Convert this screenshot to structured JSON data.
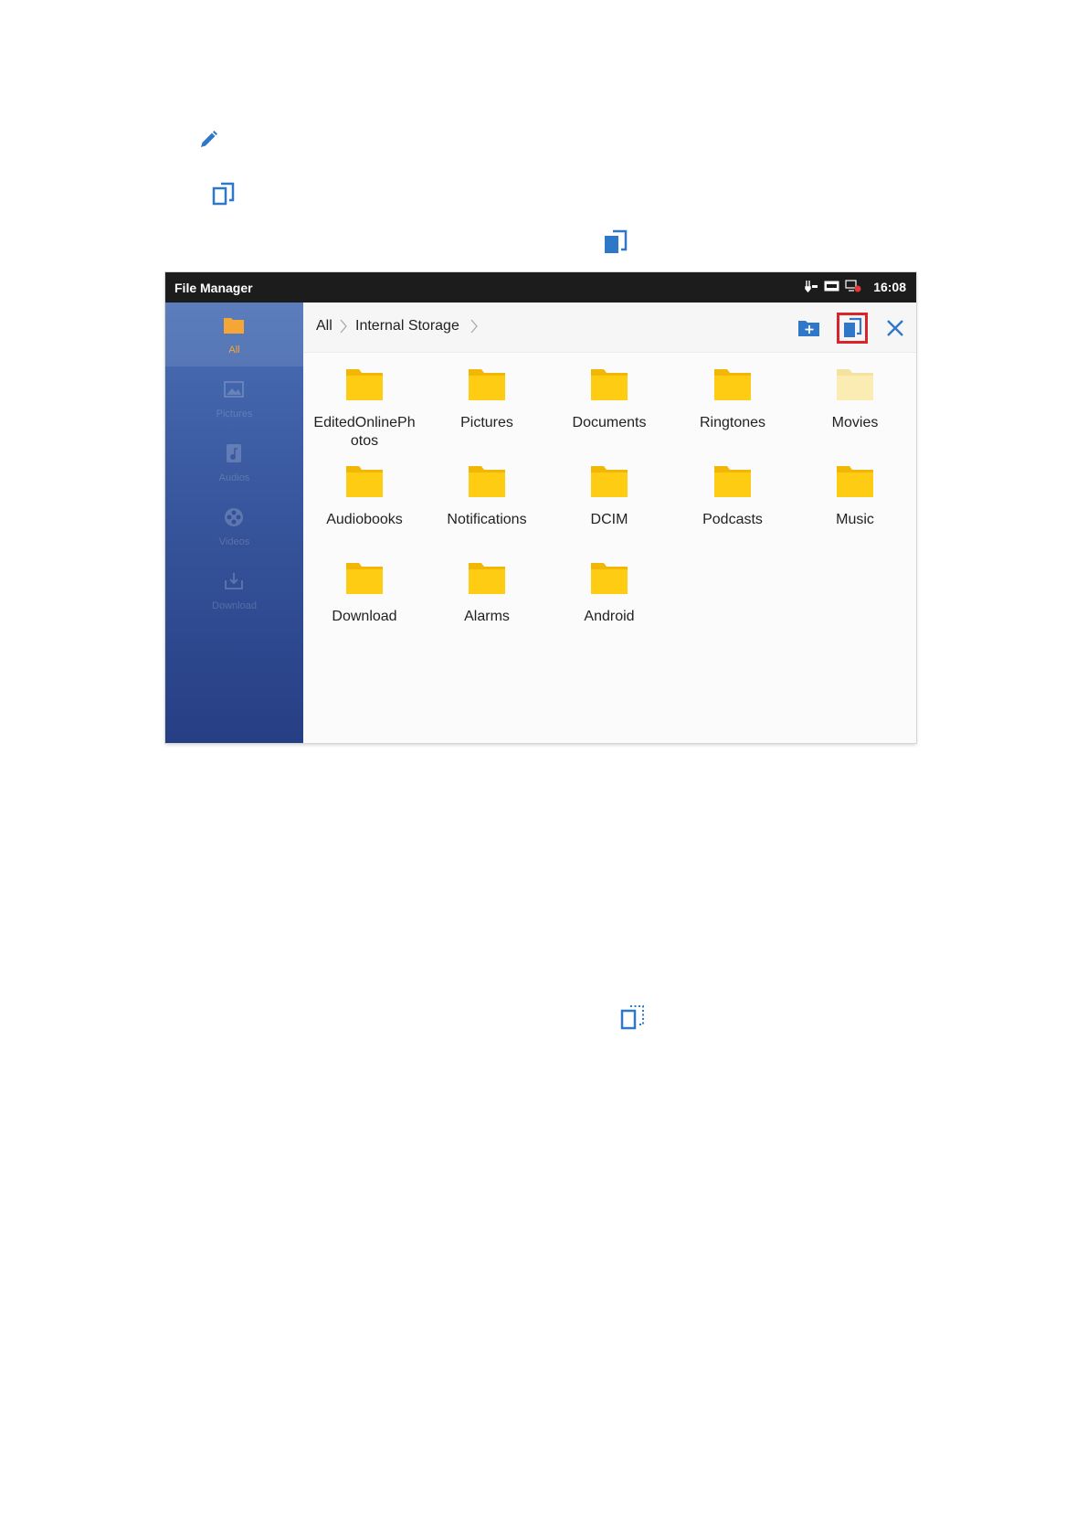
{
  "app_title": "File Manager",
  "clock": "16:08",
  "colors": {
    "accent": "#2f78c9",
    "folder": "#ffcc14",
    "folder_faded": "#fbecb3",
    "highlight": "#d9232d",
    "active_tab": "#f4a636"
  },
  "document_icons": [
    {
      "name": "pencil-icon"
    },
    {
      "name": "copy-outline-icon"
    },
    {
      "name": "copy-filled-icon"
    },
    {
      "name": "copy-dashed-icon"
    }
  ],
  "sidebar": {
    "items": [
      {
        "label": "All",
        "icon": "folder-icon",
        "active": true
      },
      {
        "label": "Pictures",
        "icon": "image-icon",
        "active": false
      },
      {
        "label": "Audios",
        "icon": "music-icon",
        "active": false
      },
      {
        "label": "Videos",
        "icon": "film-reel-icon",
        "active": false
      },
      {
        "label": "Download",
        "icon": "download-icon",
        "active": false
      }
    ]
  },
  "breadcrumb": {
    "items": [
      "All",
      "Internal Storage"
    ]
  },
  "toolbar": {
    "new_folder_icon": "new-folder-icon",
    "copy_icon": "copy-filled-icon",
    "close_icon": "close-icon"
  },
  "folders": [
    {
      "label": "EditedOnlinePh\notos",
      "faded": false
    },
    {
      "label": "Pictures",
      "faded": false
    },
    {
      "label": "Documents",
      "faded": false
    },
    {
      "label": "Ringtones",
      "faded": false
    },
    {
      "label": "Movies",
      "faded": true
    },
    {
      "label": "Audiobooks",
      "faded": false
    },
    {
      "label": "Notifications",
      "faded": false
    },
    {
      "label": "DCIM",
      "faded": false
    },
    {
      "label": "Podcasts",
      "faded": false
    },
    {
      "label": "Music",
      "faded": false
    },
    {
      "label": "Download",
      "faded": false
    },
    {
      "label": "Alarms",
      "faded": false
    },
    {
      "label": "Android",
      "faded": false
    }
  ]
}
